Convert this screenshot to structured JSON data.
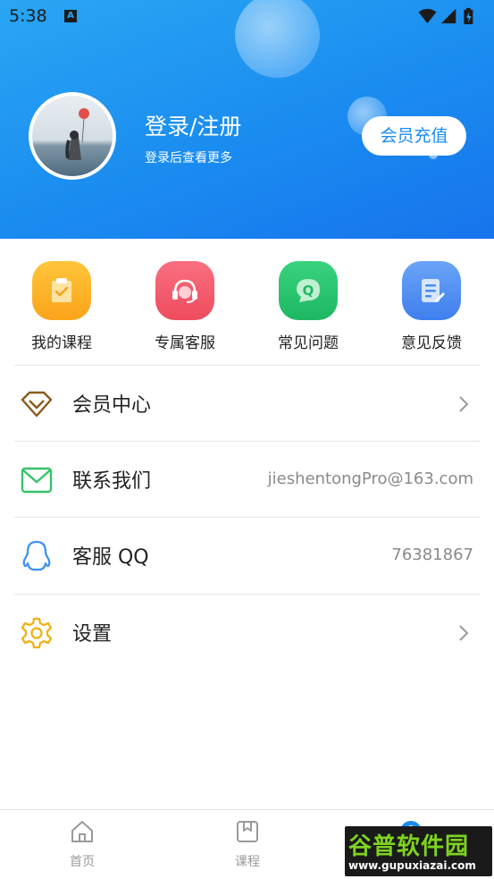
{
  "status_bar": {
    "time": "5:38",
    "a_icon": "A"
  },
  "header": {
    "login_title": "登录/注册",
    "login_subtitle": "登录后查看更多",
    "vip_button": "会员充值",
    "gradient_start": "#2aa6f3",
    "gradient_end": "#1774ec"
  },
  "quick_actions": [
    {
      "label": "我的课程",
      "icon": "clipboard-check-icon",
      "color": "#fbb01f"
    },
    {
      "label": "专属客服",
      "icon": "headset-icon",
      "color": "#f35a6b"
    },
    {
      "label": "常见问题",
      "icon": "q-chat-icon",
      "color": "#25c46a"
    },
    {
      "label": "意见反馈",
      "icon": "document-edit-icon",
      "color": "#4a8cf0"
    }
  ],
  "list": [
    {
      "label": "会员中心",
      "icon": "diamond-icon",
      "value": ""
    },
    {
      "label": "联系我们",
      "icon": "mail-icon",
      "value": "jieshentongPro@163.com"
    },
    {
      "label": "客服 QQ",
      "icon": "qq-penguin-icon",
      "value": "76381867"
    },
    {
      "label": "设置",
      "icon": "gear-icon",
      "value": ""
    }
  ],
  "bottom_nav": [
    {
      "label": "首页",
      "icon": "home-icon"
    },
    {
      "label": "课程",
      "icon": "bookmark-book-icon"
    },
    {
      "label": "",
      "icon": "user-icon"
    }
  ],
  "watermark": {
    "top": "谷普软件园",
    "bottom": "www.gupuxiazai.com"
  }
}
